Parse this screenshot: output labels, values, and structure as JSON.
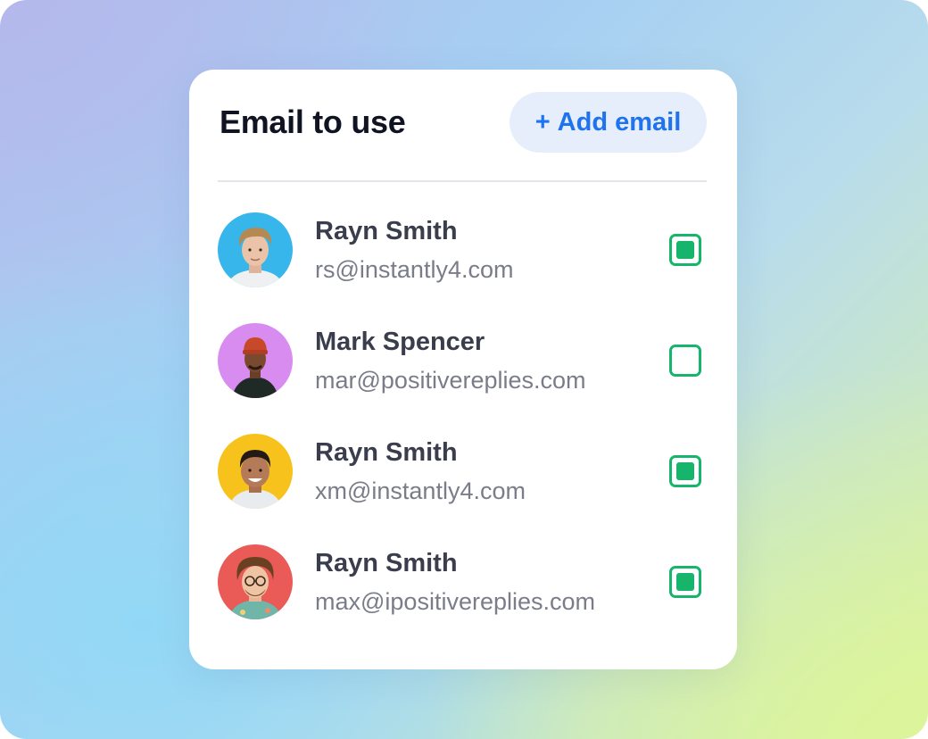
{
  "card": {
    "title": "Email to use",
    "add_button": {
      "icon": "+",
      "label": "Add email"
    }
  },
  "accounts": [
    {
      "name": "Rayn Smith",
      "email": "rs@instantly4.com",
      "checked": true,
      "avatar_bg": "#36b6ea"
    },
    {
      "name": "Mark Spencer",
      "email": "mar@positivereplies.com",
      "checked": false,
      "avatar_bg": "#d98cf0"
    },
    {
      "name": "Rayn Smith",
      "email": "xm@instantly4.com",
      "checked": true,
      "avatar_bg": "#f7c21b"
    },
    {
      "name": "Rayn Smith",
      "email": "max@ipositivereplies.com",
      "checked": true,
      "avatar_bg": "#ea5a57"
    }
  ],
  "colors": {
    "accent": "#1f73ee",
    "check": "#17b46c",
    "title": "#101322"
  }
}
